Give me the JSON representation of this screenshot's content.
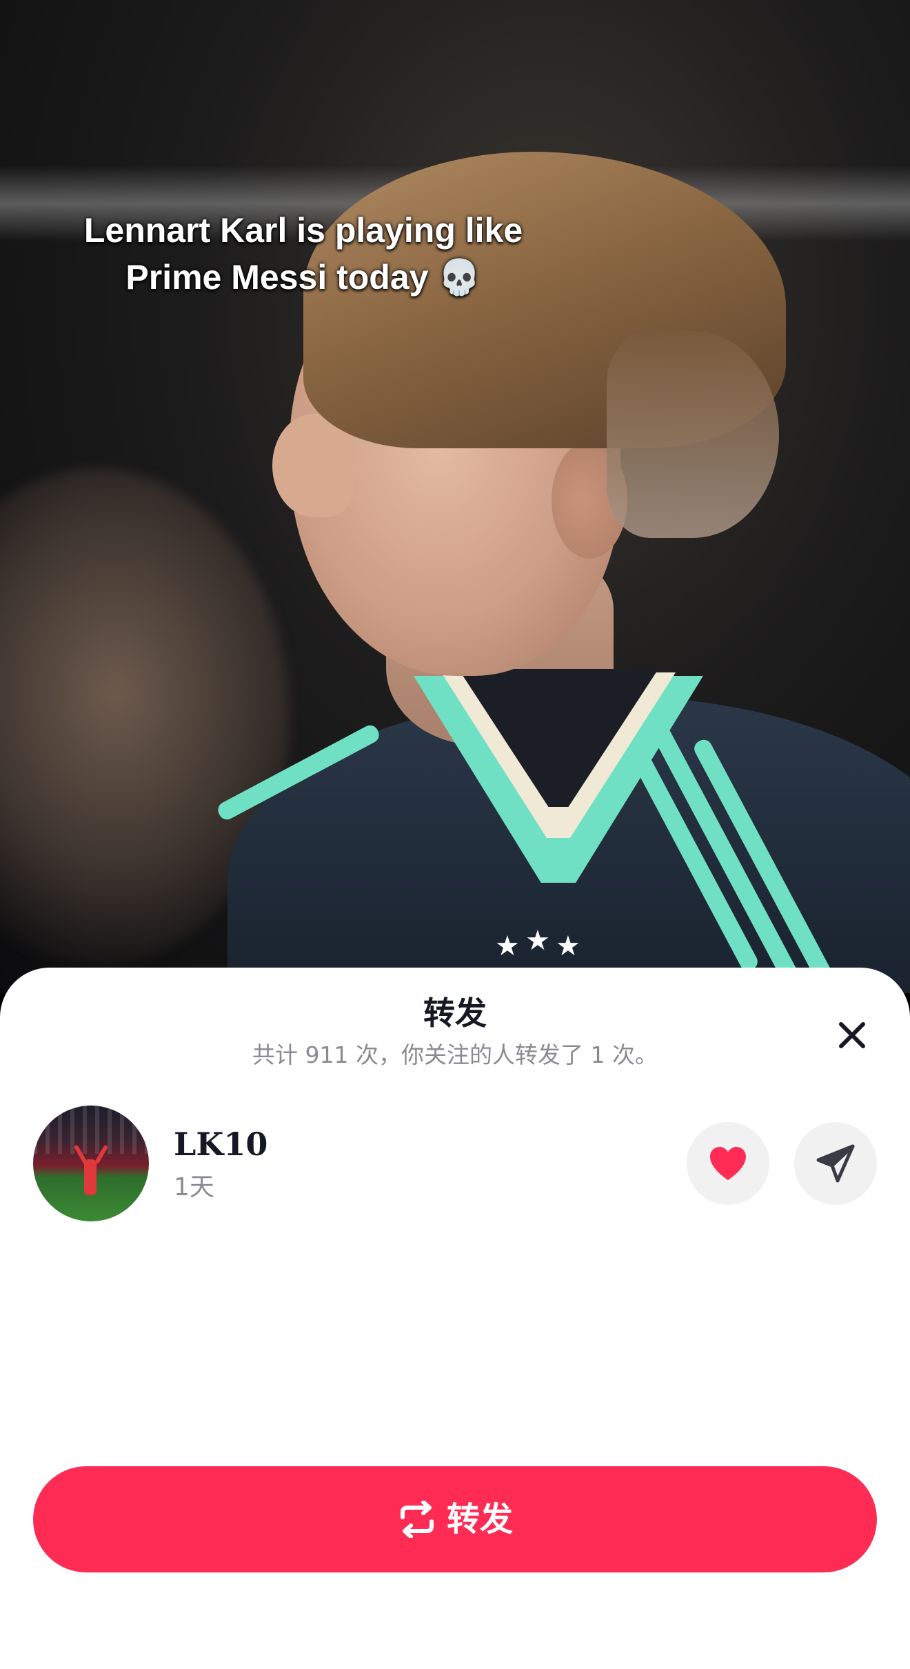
{
  "video": {
    "caption_line1": "Lennart Karl is playing like",
    "caption_line2": "Prime Messi today 💀"
  },
  "repost_sheet": {
    "title": "转发",
    "subtitle": "共计 911 次，你关注的人转发了 1 次。",
    "close_icon": "close-icon",
    "users": [
      {
        "username": "LK10",
        "time_ago": "1天",
        "liked": true,
        "actions": [
          "heart-icon",
          "send-icon"
        ]
      }
    ],
    "repost_button_label": "转发",
    "repost_icon": "repost-icon"
  },
  "colors": {
    "accent": "#fe2c55",
    "heart": "#fe2c55",
    "muted_text": "#8a8b91",
    "primary_text": "#161823",
    "round_button_bg": "#f1f1f2"
  }
}
